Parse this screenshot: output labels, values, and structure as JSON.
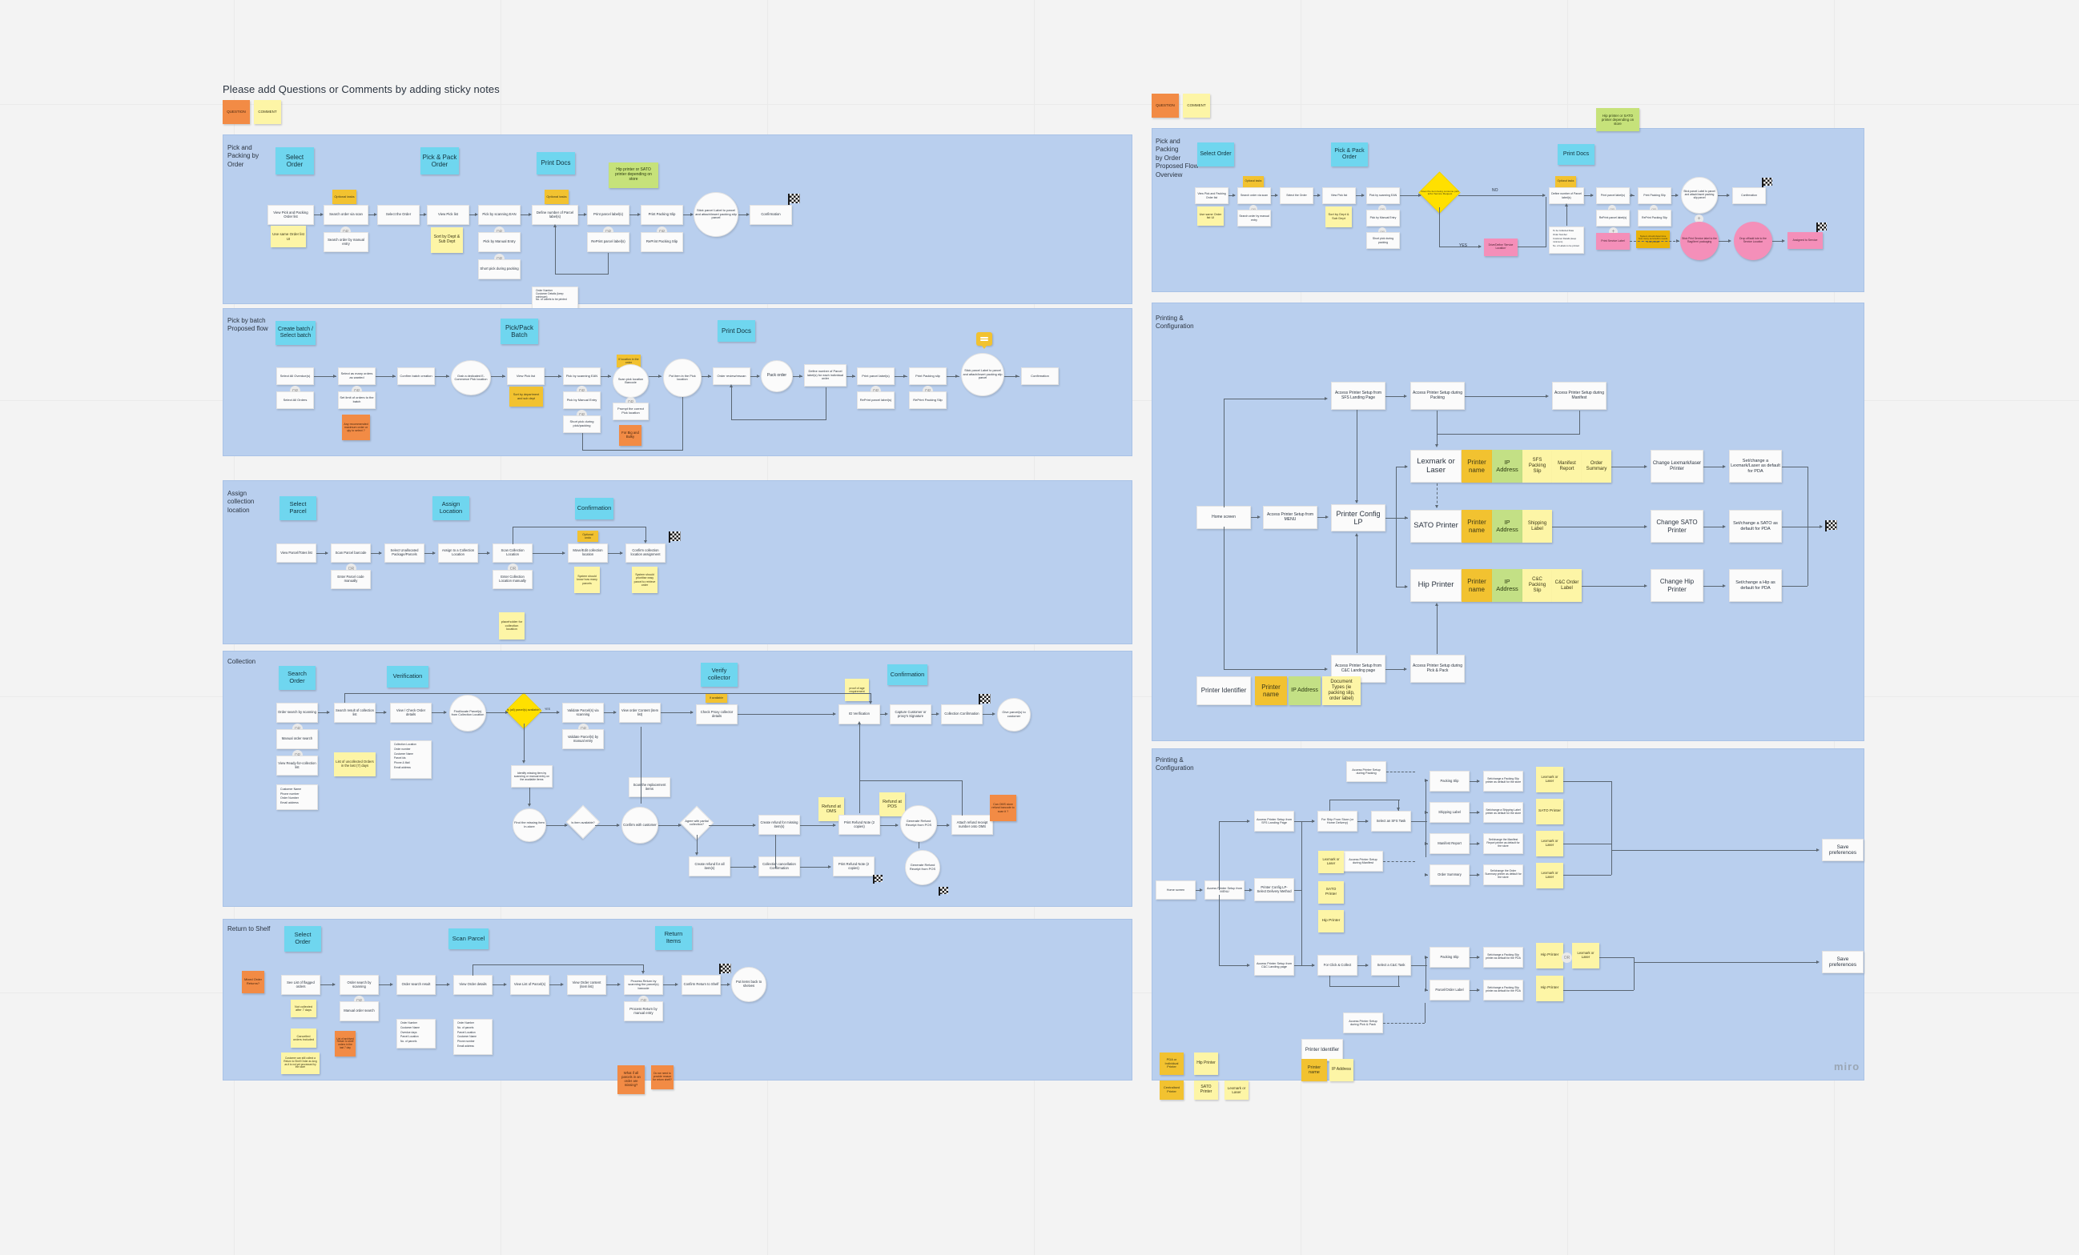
{
  "board": {
    "title": "Please add Questions or Comments by adding sticky notes",
    "watermark": "miro",
    "legend_notes": [
      {
        "label": "QUESTION",
        "color": "orange"
      },
      {
        "label": "COMMENT",
        "color": "yellow"
      }
    ]
  },
  "frames": {
    "pick_pack_order": {
      "label": "Pick and\nPacking by\nOrder",
      "headers": [
        "Select Order",
        "Pick & Pack Order",
        "Print Docs"
      ],
      "green_note": "Hip printer or SATO printer depending on store",
      "nodes": [
        "View Pick and Packing Order list",
        "Search  order via scan",
        "Search  order by manual entry",
        "Select the  Order",
        "View Pick list",
        "Pick by scanning EAN",
        "Pick by Manual Entry",
        "Short pick during packing",
        "Define number of Parcel label(s)",
        "Print parcel label(s)",
        "RePrint parcel label(s)",
        "Print Packing Slip",
        "RePrint Packing Slip",
        "Stick parcel Label to parcel and attach/insert packing slip parcel",
        "Confirmation"
      ],
      "yellow_notes": [
        "Use same Order list  UI",
        "Sort by Dept & Sub Dept"
      ],
      "gold_notes": [
        "Optional tasks",
        "Optional tasks"
      ],
      "data_list": [
        "Order Number",
        "Customer Details (keep minimum)",
        "No. of Labels to be printed"
      ],
      "or_label": "OR"
    },
    "pick_by_batch": {
      "label": "Pick by batch\nProposed flow",
      "headers": [
        "Create batch / Select batch",
        "Pick/Pack Batch",
        "Print Docs"
      ],
      "nodes": [
        "Select All Overdue(s)",
        "Select All  Orders",
        "Select as many orders as wanted",
        "Set limit of orders to the batch",
        "Confirm batch creation",
        "Grab a dedicated E-Commerce Pick location",
        "View Pick list",
        "Pick by scanning EAN",
        "Pick by Manual Entry",
        "Short pick during pick/packing",
        "Scan pick location Barcode",
        "Prompt the correct Pick location",
        "Put item in the Pick location",
        "Order review/rescan",
        "Pack order",
        "Define number of Parcel label(s) for each individual order",
        "Print parcel label(s)",
        "RePrint parcel label(s)",
        "Print Packing slip",
        "RePrint Packing Slip",
        "Stick parcel Label to parcel and attach/insert packing slip parcel",
        "Confirmation"
      ],
      "orange_notes": [
        "Any recommended maximum order or qty to select ?"
      ],
      "gold_notes": [
        "Sort by department and sub dept",
        "If location in the order"
      ],
      "orange_small": [
        "For Big and Bulky"
      ],
      "or_label": "OR"
    },
    "assign_collection": {
      "label": "Assign\ncollection\nlocation",
      "headers": [
        "Select Parcel",
        "Assign Location",
        "Confirmation"
      ],
      "nodes": [
        "View Parcel/Totes list",
        "Scan Parcel barcode",
        "Enter Parcel code manually",
        "Select Unallocated Package/Parcels",
        "Assign to a Collection Location",
        "Scan Collection Location",
        "Enter Collection Location manually",
        "Move/Edit collection location",
        "Confirm collection location assignment"
      ],
      "yellow_notes": [
        "placeholder for collection location",
        "System should know how many parcels",
        "System should prioritise  easy parcel to retrieve order"
      ],
      "gold_notes": [
        "Optional undo"
      ],
      "or_label": "OR"
    },
    "collection": {
      "label": "Collection",
      "headers": [
        "Search Order",
        "Verification",
        "Verify collector",
        "Confirmation"
      ],
      "nodes": [
        "Order search by scanning",
        "Manual order search",
        "View Ready-for-collection list",
        "Search result of collection list",
        "View / Check Order details",
        "Find/locate Parcel(s) from Collection Location",
        "Validate Parcel(s) via scanning",
        "Validate Parcel(s) by manual entry",
        "View order Content (item list)",
        "Check Proxy collector details",
        "ID Verification",
        "Capture Customer or proxy's Signature",
        "Collection Confirmation",
        "Give parcel(s) to customer",
        "Identify missing item by scanning or manual entry on the available items",
        "Find the missing item in-store",
        "Scan the replacement items",
        "Confirm with customer",
        "Create refund for missing item(s)",
        "Print Refund Note (2 copies)",
        "Generate Refund Receipt from POS",
        "Attach refund receipt number onto OMS",
        "Create refund for all item(s)",
        "Collection cancellation Confirmation",
        "Print Refund Note (2 copies)",
        "Generate Refund Receipt from POS"
      ],
      "decisions": [
        "Is (all) parcel(s) available?",
        "Is item available?",
        "Agree with partial collection?"
      ],
      "search_fields": [
        "Customer Name",
        "Phone number",
        "Order Number",
        "Email address"
      ],
      "detail_fields": [
        "Collection Location",
        "Order number",
        "Customer Name",
        "Parcel ids",
        "Phone & Mail",
        "Email address"
      ],
      "yellow_notes": [
        "List of uncollected Orders in the last (7) days",
        "proof of age requirement"
      ],
      "gold_notes": [
        "If available"
      ],
      "orange_notes": [
        "Can OMS store refund barcode to scan it ?"
      ],
      "refund_headers": [
        "Refund at OMS",
        "Refund at POS"
      ],
      "edge_labels": [
        "YES",
        "NO"
      ],
      "or_label": "OR"
    },
    "return_to_shelf": {
      "label": "Return to Shelf",
      "headers": [
        "Select Order",
        "Scan Parcel",
        "Return Items"
      ],
      "nodes": [
        "See List of flagged orders",
        "Order search by scanning",
        "Manual order search",
        "Order search result",
        "View Order details",
        "View List of Parcel(s)",
        "View Order content (item list)",
        "Process Return by scanning  the parcel(s) barcode",
        "Process Return by manual entry",
        "Confirm Return to Shelf",
        "Put items back to shelves"
      ],
      "order_fields": [
        "Order Number",
        "Customer Name",
        "Overdue days",
        "Parcel Location",
        "No. of parcels"
      ],
      "parcel_fields": [
        "Order Number",
        "No. of parcels",
        "Parcel Location",
        "Customer Name",
        "Phone number",
        "Email address"
      ],
      "yellow_notes": [
        "Not collected after 7 days",
        "Cancelled orders included",
        "Customer can still collect a Return to Shelf Order as long as it is not yet processed by the store"
      ],
      "orange_notes": [
        "Mixed Order Returns?",
        "List of archived Return to shelf orders in the last 7 day",
        "What if all parcels in an order are missing?",
        "Do we need to provide reason for return shelf?"
      ],
      "or_label": "OR"
    },
    "pick_pack_overview": {
      "label": "Pick and Packing\nby Order\nProposed Flow\nOverview",
      "headers": [
        "Select Order",
        "Pick & Pack Order",
        "Print Docs"
      ],
      "green_note": "Hip printer or SATO printer depending on store",
      "nodes": [
        "View Pick and Packing Order list",
        "Search  order via scan",
        "Search  order by manual entry",
        "Select the  Order",
        "View Pick list",
        "Pick by scanning EAN",
        "Pick by Manual Entry",
        "Short pick during packing",
        "Define number of Parcel label(s)",
        "Print parcel label(s)",
        "RePrint parcel label(s)",
        "Print Service Label",
        "Print Packing Slip",
        "RePrint Packing Slip",
        "Stick parcel Label to parcel and attach/insert packing slip parcel",
        "Confirmation",
        "Stick Print Service label to the 'Bag/Item' packaging",
        "Drop off/add tote to the Service Location",
        "Assigned to Service"
      ],
      "decision": "Does the item being consume pick to/for Service Request",
      "yellow_notes": [
        "Use same Order list  UI",
        "Sort by Dept & Sub Dept",
        "System should determine how many service/bin needs to be printed"
      ],
      "gold_notes": [
        "Optional tasks",
        "Optional tasks"
      ],
      "pink_nodes": [
        "Drive/Define 'Service Location'"
      ],
      "data_list": [
        "To be Collected Data",
        "Order Number",
        "Customer Details (keep minimum)",
        "No. of Labels to be printed"
      ],
      "edge_labels": [
        "NO",
        "YES"
      ],
      "or_label": "OR"
    },
    "printing_config_1": {
      "label": "Printing &\nConfiguration",
      "nodes": [
        "Home screen",
        "Access Printer Setup from MENU",
        "Printer Config LP",
        "Access Printer Setup from SFS Landing Page",
        "Access Printer Setup during Packing",
        "Access Printer Setup during Manifest",
        "Access Printer Setup from C&C Landing page",
        "Access Printer Setup during Pick & Pack",
        "Lexmark or Laser",
        "SATO Printer",
        "Hip Printer",
        "Change Lexmark/laser Printer",
        "Change SATO Printer",
        "Change Hip Printer",
        "Set/change a Lexmark/Laser  as default for  PDA",
        "Set/change a SATO as default for  PDA",
        "Set/change a Hip as default for PDA"
      ],
      "gold_notes": [
        "Printer name",
        "Printer name",
        "Printer name"
      ],
      "green_notes": [
        "IP Address",
        "IP Address",
        "IP Address"
      ],
      "yellow_notes": [
        "SFS Packing Slip",
        "Manifest Report",
        "Order Summary",
        "Shipping Label",
        "C&C Packing Slip",
        "C&C Order Label"
      ],
      "legend": {
        "printer_identifier": "Printer Identifier",
        "printer_name": "Printer name",
        "ip_address": "IP Address",
        "document_types": "Document Types (ie packing slip, order label)"
      }
    },
    "printing_config_2": {
      "label": "Printing &\nConfiguration",
      "nodes": [
        "Home screen",
        "Access Printer Setup from MENU",
        "Printer Config LP- Select Delivery Method",
        "Access Printer Setup from SFS Landing Page",
        "Access Printer Setup during Packing",
        "Access Printer Setup during Manifest",
        "Access Printer Setup from C&C Landing page",
        "Access Printer Setup during Pick & Pack",
        "For Ship From Store (or Home Delivery)",
        "Select an SFS Task",
        "For Click & Collect",
        "Select a C&C Task",
        "Packing Slip",
        "Shipping Label",
        "Manifest Report",
        "Order Summary",
        "Set/change a Packing Slip printer as default for the store",
        "Set/change a Shipping Label printer as default for the store",
        "Set/change the Manifest Report printer as default for the store",
        "Set/change the Order Summary printer as default for the store",
        "Packing Slip",
        "Parcel/Order Label",
        "Set/change a Packing Slip printer as default for the PDA",
        "Set/change a Packing Slip printer as default for the PDA",
        "Save preferences",
        "Save preferences"
      ],
      "yellow_notes": [
        "Lexmark or Laser",
        "SATO Printer",
        "Hip Printer",
        "Lexmark or Laser",
        "SATO Printer",
        "Lexmark or Laser",
        "Lexmark or Laser",
        "Hip Printer",
        "Lexmark or Laser",
        "Hip Printer"
      ],
      "legend": {
        "printer_identifier": "Printer Identifier",
        "printer_name": "Printer name",
        "ip_address": "IP Address",
        "pda_note": "PDA or Individual Printer",
        "centralised_note": "Centralised Printer",
        "hip": "Hip Printer",
        "sato": "SATO Printer",
        "lexmark": "Lexmark or Laser"
      },
      "or_label": "OR"
    }
  }
}
